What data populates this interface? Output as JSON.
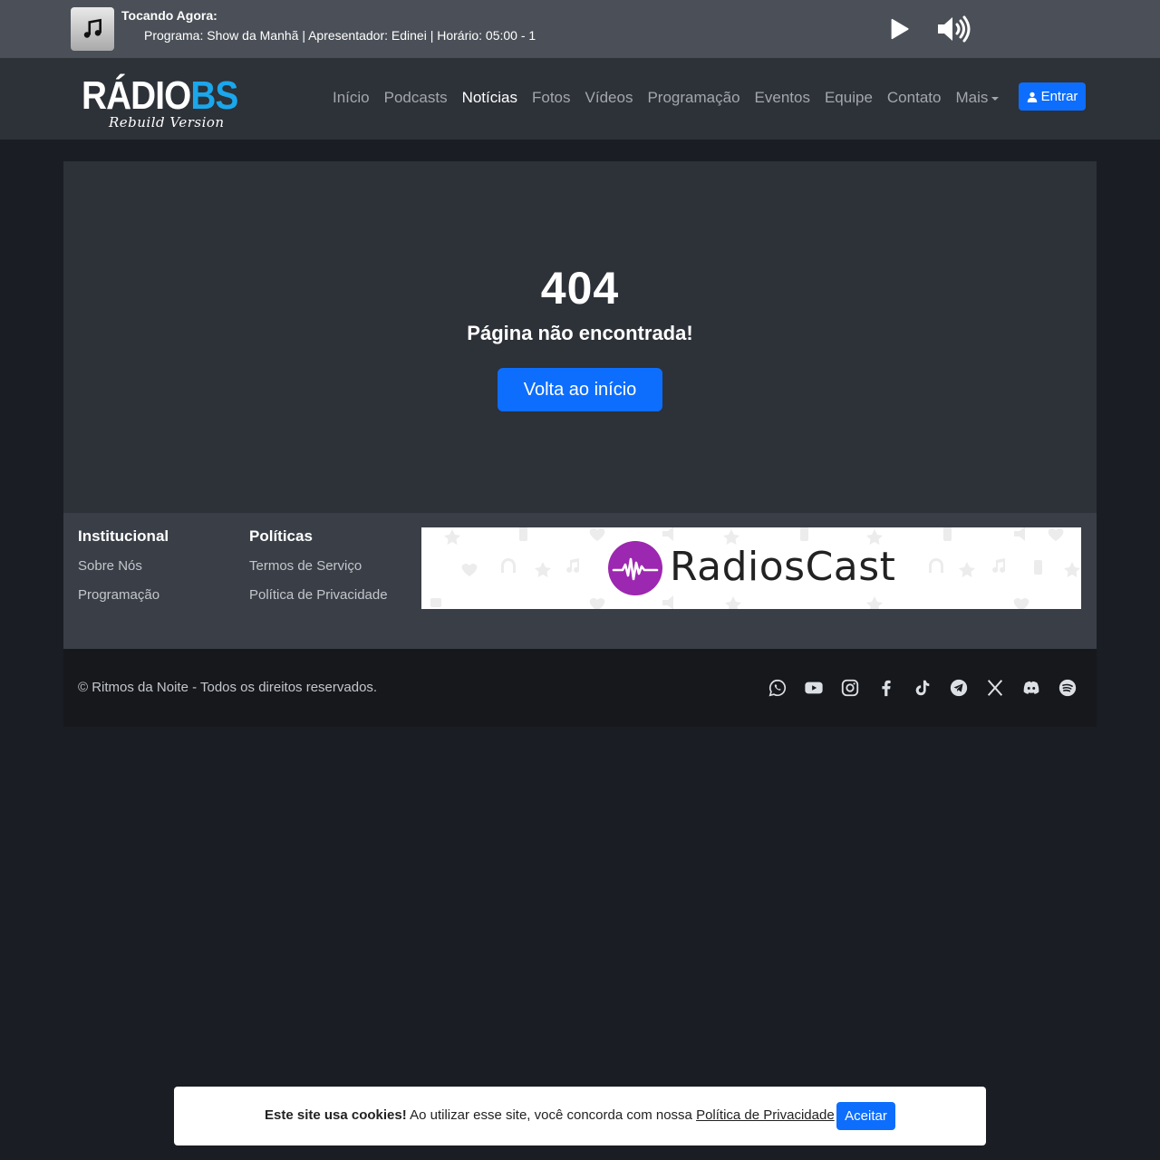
{
  "player": {
    "now_playing_label": "Tocando Agora:",
    "now_playing_text": "Programa: Show da Manhã | Apresentador: Edinei | Horário: 05:00 - 1",
    "cover_icon": "music-note-icon",
    "play_icon": "play-icon",
    "volume_icon": "volume-up-icon"
  },
  "navbar": {
    "brand_main": "RÁDIO",
    "brand_accent": "BS",
    "brand_tagline": "Rebuild Version",
    "links": [
      {
        "label": "Início",
        "active": false
      },
      {
        "label": "Podcasts",
        "active": false
      },
      {
        "label": "Notícias",
        "active": true
      },
      {
        "label": "Fotos",
        "active": false
      },
      {
        "label": "Vídeos",
        "active": false
      },
      {
        "label": "Programação",
        "active": false
      },
      {
        "label": "Eventos",
        "active": false
      },
      {
        "label": "Equipe",
        "active": false
      },
      {
        "label": "Contato",
        "active": false
      },
      {
        "label": "Mais",
        "active": false
      }
    ],
    "login_label": "Entrar",
    "accent_color": "#1aa7ec"
  },
  "main": {
    "error_code": "404",
    "error_message": "Página não encontrada!",
    "home_button_label": "Volta ao início"
  },
  "footer": {
    "columns": [
      {
        "title": "Institucional",
        "links": [
          "Sobre Nós",
          "Programação"
        ]
      },
      {
        "title": "Políticas",
        "links": [
          "Termos de Serviço",
          "Política de Privacidade"
        ]
      }
    ],
    "banner_text": "RadiosCast",
    "banner_color": "#9c27b0",
    "copyright": "© Ritmos da Noite - Todos os direitos reservados.",
    "social_icons": [
      "whatsapp-icon",
      "youtube-icon",
      "instagram-icon",
      "facebook-icon",
      "tiktok-icon",
      "telegram-icon",
      "x-icon",
      "discord-icon",
      "spotify-icon"
    ]
  },
  "cookie": {
    "bold_text": "Este site usa cookies!",
    "text": " Ao utilizar esse site, você concorda com nossa ",
    "link_text": "Política de Privacidade",
    "accept_label": "Aceitar"
  },
  "colors": {
    "primary": "#0d6efd",
    "page_bg": "#1a1d23",
    "card_bg": "#2d3138"
  }
}
